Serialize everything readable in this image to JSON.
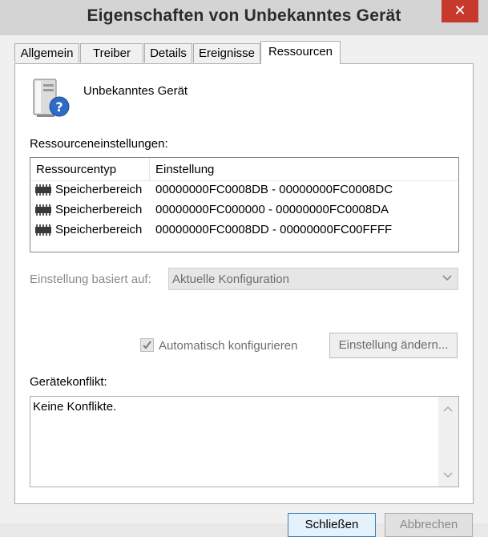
{
  "window": {
    "title": "Eigenschaften von Unbekanntes Gerät",
    "close_glyph": "✕"
  },
  "tabs": [
    {
      "label": "Allgemein",
      "active": false
    },
    {
      "label": "Treiber",
      "active": false
    },
    {
      "label": "Details",
      "active": false
    },
    {
      "label": "Ereignisse",
      "active": false
    },
    {
      "label": "Ressourcen",
      "active": true
    }
  ],
  "device": {
    "name": "Unbekanntes Gerät",
    "icon": "unknown-device-icon"
  },
  "resources": {
    "section_label": "Ressourceneinstellungen:",
    "columns": [
      "Ressourcentyp",
      "Einstellung"
    ],
    "rows": [
      {
        "type": "Speicherbereich",
        "setting": "00000000FC0008DB - 00000000FC0008DC"
      },
      {
        "type": "Speicherbereich",
        "setting": "00000000FC000000 - 00000000FC0008DA"
      },
      {
        "type": "Speicherbereich",
        "setting": "00000000FC0008DD - 00000000FC00FFFF"
      }
    ]
  },
  "config": {
    "label": "Einstellung basiert auf:",
    "selected": "Aktuelle Konfiguration",
    "enabled": false
  },
  "auto_configure": {
    "label": "Automatisch konfigurieren",
    "checked": true,
    "enabled": false
  },
  "change_setting_button": "Einstellung ändern...",
  "conflict": {
    "label": "Gerätekonflikt:",
    "text": "Keine Konflikte."
  },
  "footer": {
    "ok_label": "Schließen",
    "cancel_label": "Abbrechen"
  },
  "colors": {
    "close_button": "#c7392b",
    "disabled_text": "#6d6d6d"
  }
}
